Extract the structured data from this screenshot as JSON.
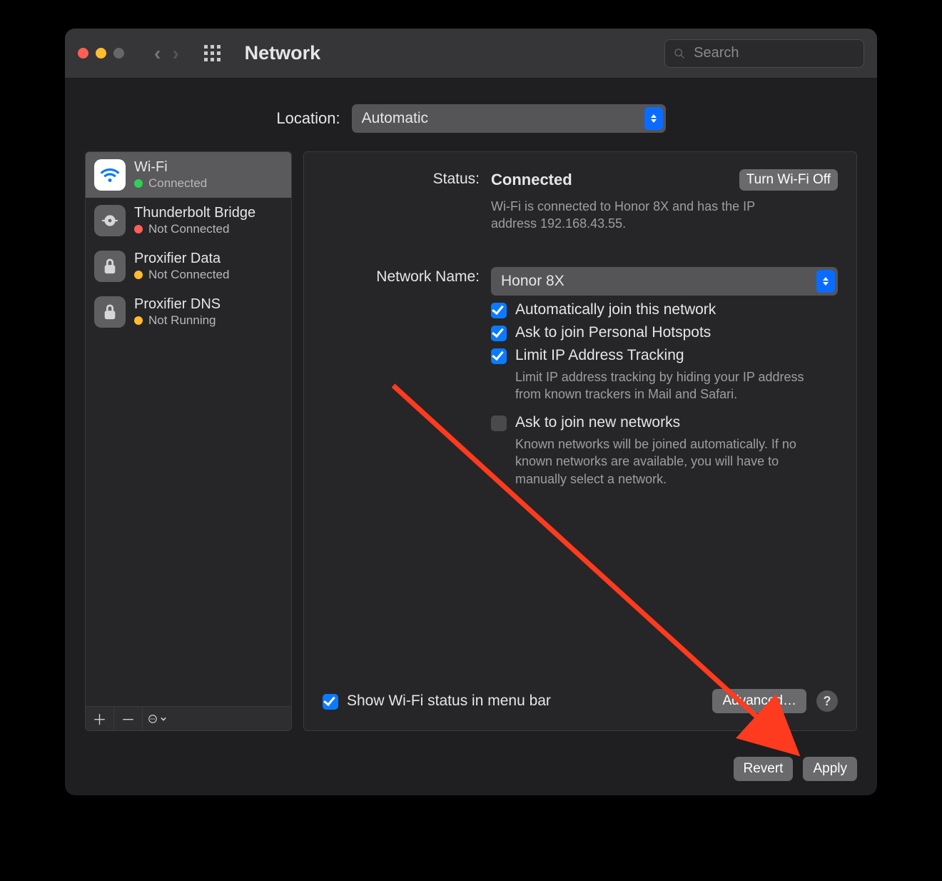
{
  "titlebar": {
    "title": "Network"
  },
  "search": {
    "placeholder": "Search"
  },
  "location": {
    "label": "Location:",
    "value": "Automatic"
  },
  "sidebar": {
    "services": [
      {
        "name": "Wi-Fi",
        "status": "Connected",
        "status_color": "green",
        "icon": "wifi",
        "selected": true
      },
      {
        "name": "Thunderbolt Bridge",
        "status": "Not Connected",
        "status_color": "red",
        "icon": "thunderbolt",
        "selected": false
      },
      {
        "name": "Proxifier Data",
        "status": "Not Connected",
        "status_color": "yellow",
        "icon": "lock",
        "selected": false
      },
      {
        "name": "Proxifier DNS",
        "status": "Not Running",
        "status_color": "yellow",
        "icon": "lock",
        "selected": false
      }
    ]
  },
  "main": {
    "status_label": "Status:",
    "status_value": "Connected",
    "turn_off_label": "Turn Wi-Fi Off",
    "status_detail": "Wi-Fi is connected to Honor 8X and has the IP address 192.168.43.55.",
    "network_name_label": "Network Name:",
    "network_name_value": "Honor 8X",
    "checks": {
      "auto_join": {
        "label": "Automatically join this network",
        "checked": true
      },
      "hotspot": {
        "label": "Ask to join Personal Hotspots",
        "checked": true
      },
      "limit_ip": {
        "label": "Limit IP Address Tracking",
        "checked": true,
        "desc": "Limit IP address tracking by hiding your IP address from known trackers in Mail and Safari."
      },
      "ask_new": {
        "label": "Ask to join new networks",
        "checked": false,
        "desc": "Known networks will be joined automatically. If no known networks are available, you will have to manually select a network."
      }
    },
    "show_menu_bar": {
      "label": "Show Wi-Fi status in menu bar",
      "checked": true
    },
    "advanced_label": "Advanced…",
    "help_label": "?"
  },
  "buttons": {
    "revert": "Revert",
    "apply": "Apply"
  }
}
